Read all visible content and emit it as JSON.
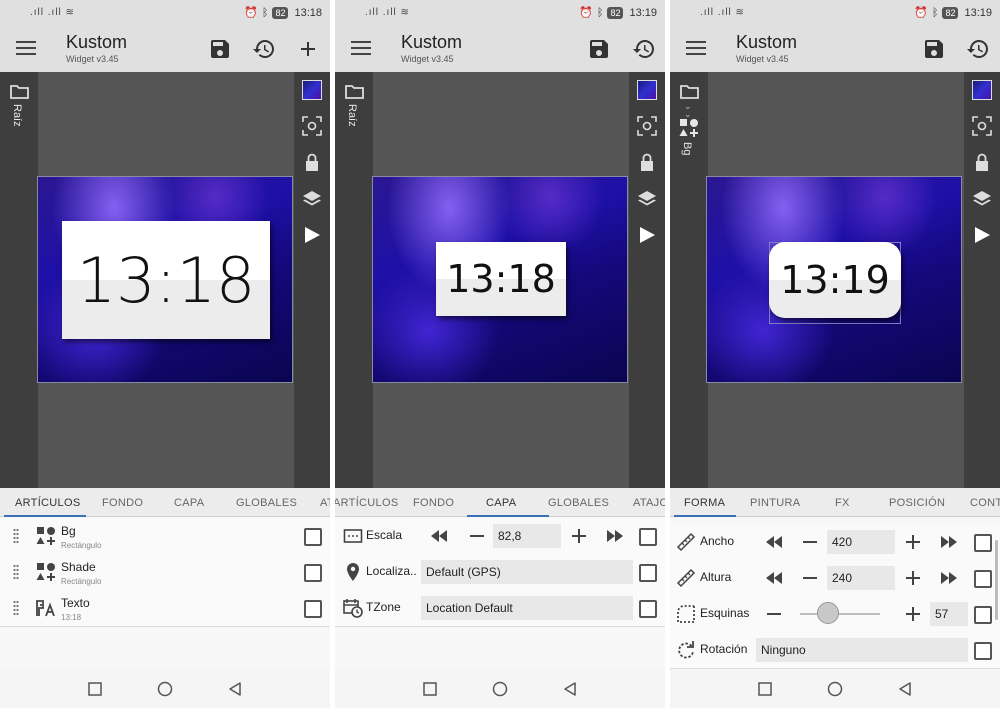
{
  "panels": [
    {
      "status": {
        "battery": "82",
        "time": "13:18"
      },
      "app": {
        "title": "Kustom",
        "subtitle": "Widget v3.45"
      },
      "left_label": "Raíz",
      "clock": "13:18",
      "tabs": [
        "ARTÍCULOS",
        "FONDO",
        "CAPA",
        "GLOBALES",
        "ATAJOS"
      ],
      "rows": [
        {
          "title": "Bg",
          "sub": "Rectángulo"
        },
        {
          "title": "Shade",
          "sub": "Rectángulo"
        },
        {
          "title": "Texto",
          "sub": "13:18"
        }
      ]
    },
    {
      "status": {
        "battery": "82",
        "time": "13:19"
      },
      "app": {
        "title": "Kustom",
        "subtitle": "Widget v3.45"
      },
      "left_label": "Raíz",
      "clock": "13:18",
      "tabs": [
        "ARTÍCULOS",
        "FONDO",
        "CAPA",
        "GLOBALES",
        "ATAJOS"
      ],
      "rows": [
        {
          "label": "Escala",
          "value": "82,8"
        },
        {
          "label": "Localiza..",
          "value": "Default (GPS)"
        },
        {
          "label": "TZone",
          "value": "Location Default"
        }
      ]
    },
    {
      "status": {
        "battery": "82",
        "time": "13:19"
      },
      "app": {
        "title": "Kustom",
        "subtitle": "Widget v3.45"
      },
      "left_label": "Bg",
      "clock": "13:19",
      "tabs": [
        "FORMA",
        "PINTURA",
        "FX",
        "POSICIÓN",
        "CONTORNO"
      ],
      "rows": [
        {
          "label": "Ancho",
          "value": "420"
        },
        {
          "label": "Altura",
          "value": "240"
        },
        {
          "label": "Esquinas",
          "value": "57",
          "slider_fraction": 0.3
        },
        {
          "label": "Rotación",
          "value": "Ninguno"
        }
      ]
    }
  ],
  "icons": {
    "menu": "menu-icon",
    "save": "save-icon",
    "history": "history-icon",
    "add": "plus-icon",
    "folder": "folder-icon",
    "preview": "thumbnail-preview",
    "focus": "focus-icon",
    "lock": "lock-icon",
    "layers": "layers-icon",
    "play": "play-icon"
  }
}
